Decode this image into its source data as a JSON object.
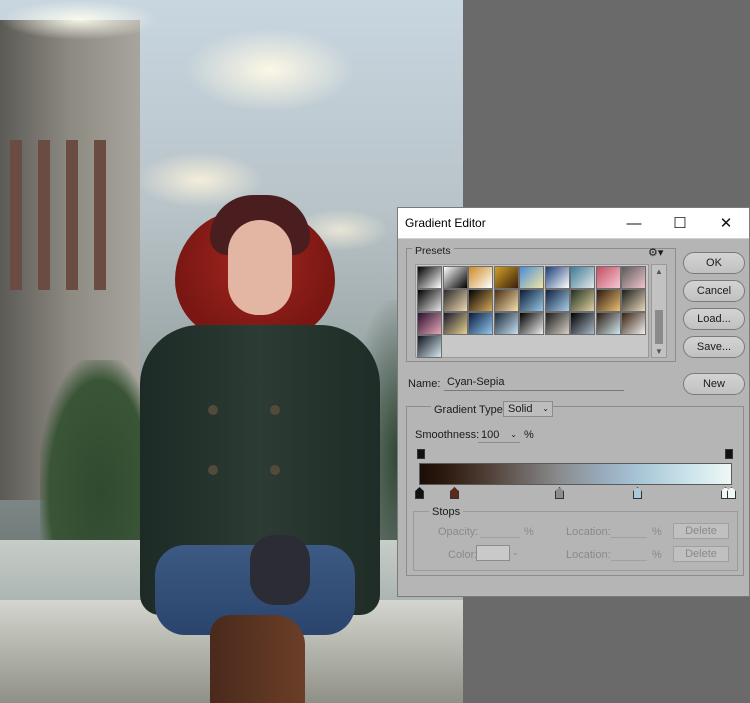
{
  "dialog": {
    "title": "Gradient Editor",
    "controls": {
      "minimize": "—",
      "maximize": "☐",
      "close": "✕"
    },
    "presets_label": "Presets",
    "buttons": {
      "ok": "OK",
      "cancel": "Cancel",
      "load": "Load...",
      "save": "Save...",
      "new": "New"
    },
    "name_label": "Name:",
    "name_value": "Cyan-Sepia",
    "gradient_type_label": "Gradient Type:",
    "gradient_type_value": "Solid",
    "smoothness_label": "Smoothness:",
    "smoothness_value": "100",
    "smoothness_unit": "%",
    "stops": {
      "label": "Stops",
      "opacity_label": "Opacity:",
      "opacity_unit": "%",
      "location_label": "Location:",
      "location_unit": "%",
      "color_label": "Color:",
      "delete_label": "Delete"
    }
  },
  "presets": [
    [
      "#000000|#ffffff",
      "#ffffff|#000000",
      "#cc8a24|#ffffff",
      "#d2a02a|#3a1e0a",
      "#4b8cd6|#f2e7a3",
      "#1b3f7a|#ffffff",
      "#3b7d9a|#e6e6e6",
      "#c44e62|#f7c8d4",
      "#5a5a5a|#f0c4cc"
    ],
    [
      "#000000|#e6e6e6",
      "#2b2b2b|#f0d8b0",
      "#000000|#d6a85a",
      "#4a2e14|#f4e0b0",
      "#0b1b33|#96c8e6",
      "#102040|#a8d0ea",
      "#203020|#e0d0a0",
      "#301810|#e8c070",
      "#1c1c1c|#e8d8b8"
    ],
    [
      "#2a0f2e|#e6a8b8",
      "#1a1a2a|#e6d090",
      "#0a1a3a|#90c8f0",
      "#1a2a3a|#c8e0f0",
      "#000000|#f0f0f0",
      "#1a1a1a|#d8d0c8",
      "#000000|#aab8c8",
      "#2c1a10|#d0e8ee",
      "#3a2010|#f0f0f0"
    ],
    [
      "#0e1420|#d6e8f0"
    ]
  ],
  "gradient_stops": {
    "color_positions": [
      0,
      0.11,
      0.45,
      0.7,
      1.0
    ],
    "opacity_positions": [
      0,
      1.0
    ]
  },
  "colors": {
    "dialog_bg": "#b5b5b5",
    "titlebar": "#ffffff",
    "workspace": "#6a6a6a"
  },
  "icons": [
    "gear-icon",
    "scroll-up-icon",
    "scroll-down-icon",
    "dropdown-arrow-icon"
  ]
}
